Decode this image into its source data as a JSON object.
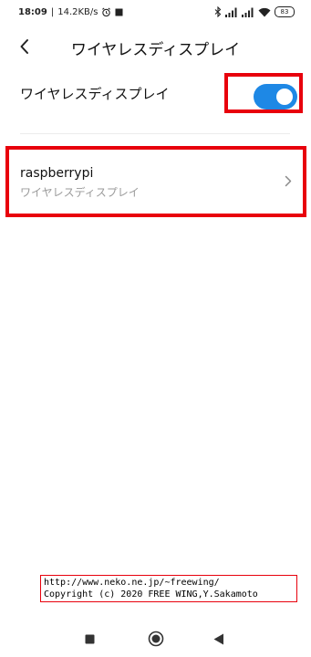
{
  "status_bar": {
    "time": "18:09",
    "speed": "14.2KB/s",
    "battery": "83",
    "icons": [
      "alarm-icon",
      "notification-square-icon",
      "bluetooth-icon",
      "signal-icon",
      "signal-icon",
      "wifi-icon",
      "battery-icon"
    ]
  },
  "header": {
    "title": "ワイヤレスディスプレイ",
    "back_icon": "back-arrow-icon"
  },
  "toggle_row": {
    "label": "ワイヤレスディスプレイ",
    "enabled": true,
    "accent_color": "#1e88e5"
  },
  "devices": [
    {
      "name": "raspberrypi",
      "subtitle": "ワイヤレスディスプレイ",
      "icon": "chevron-right-icon"
    }
  ],
  "copyright": {
    "line1": "http://www.neko.ne.jp/~freewing/",
    "line2": "Copyright (c) 2020 FREE WING,Y.Sakamoto"
  },
  "highlight_color": "#e8000c",
  "nav_bar": {
    "icons": [
      "recents-square-icon",
      "home-circle-icon",
      "back-triangle-icon"
    ]
  }
}
